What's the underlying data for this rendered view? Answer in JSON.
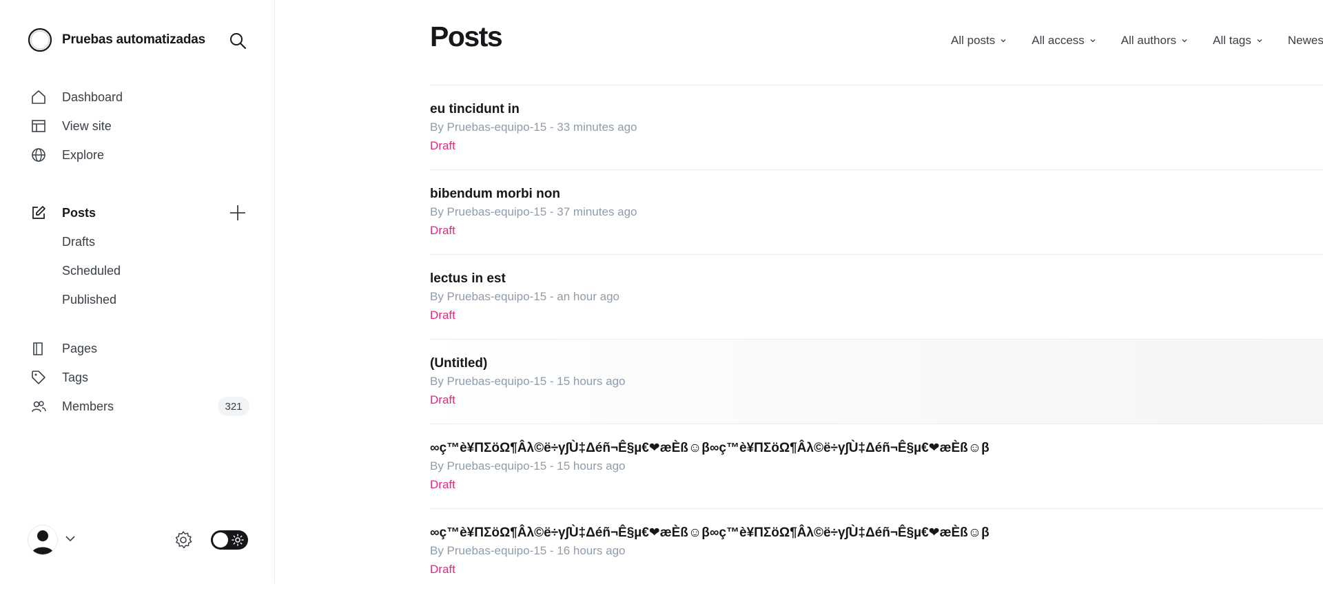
{
  "sidebar": {
    "site_name": "Pruebas automatizadas",
    "nav": {
      "dashboard": "Dashboard",
      "view_site": "View site",
      "explore": "Explore",
      "posts": "Posts",
      "drafts": "Drafts",
      "scheduled": "Scheduled",
      "published": "Published",
      "pages": "Pages",
      "tags": "Tags",
      "members": "Members",
      "members_count": "321"
    }
  },
  "main": {
    "title": "Posts",
    "filters": [
      "All posts",
      "All access",
      "All authors",
      "All tags",
      "Newest first"
    ],
    "posts": [
      {
        "title": "eu tincidunt in",
        "meta": "By Pruebas-equipo-15 - 33 minutes ago",
        "status": "Draft"
      },
      {
        "title": "bibendum morbi non",
        "meta": "By Pruebas-equipo-15 - 37 minutes ago",
        "status": "Draft"
      },
      {
        "title": "lectus in est",
        "meta": "By Pruebas-equipo-15 - an hour ago",
        "status": "Draft"
      },
      {
        "title": "(Untitled)",
        "meta": "By Pruebas-equipo-15 - 15 hours ago",
        "status": "Draft"
      },
      {
        "title": "∞ç™è¥ΠΣöΩ¶Âλ©ë÷γ∫Ù‡Δéñ¬Ê§µ€❤æÈß☺β∞ç™è¥ΠΣöΩ¶Âλ©ë÷γ∫Ù‡Δéñ¬Ê§µ€❤æÈß☺β",
        "meta": "By Pruebas-equipo-15 - 15 hours ago",
        "status": "Draft"
      },
      {
        "title": "∞ç™è¥ΠΣöΩ¶Âλ©ë÷γ∫Ù‡Δéñ¬Ê§µ€❤æÈß☺β∞ç™è¥ΠΣöΩ¶Âλ©ë÷γ∫Ù‡Δéñ¬Ê§µ€❤æÈß☺β",
        "meta": "By Pruebas-equipo-15 - 16 hours ago",
        "status": "Draft"
      }
    ]
  },
  "colors": {
    "draft": "#e6287c",
    "text": "#15171a",
    "muted": "#8e9cac"
  },
  "icons": [
    "ghost-logo-icon",
    "search-icon",
    "home-icon",
    "layout-icon",
    "globe-icon",
    "edit-icon",
    "plus-icon",
    "book-icon",
    "tag-icon",
    "members-icon",
    "user-avatar-icon",
    "chevron-down-icon",
    "gear-icon",
    "sun-icon"
  ]
}
